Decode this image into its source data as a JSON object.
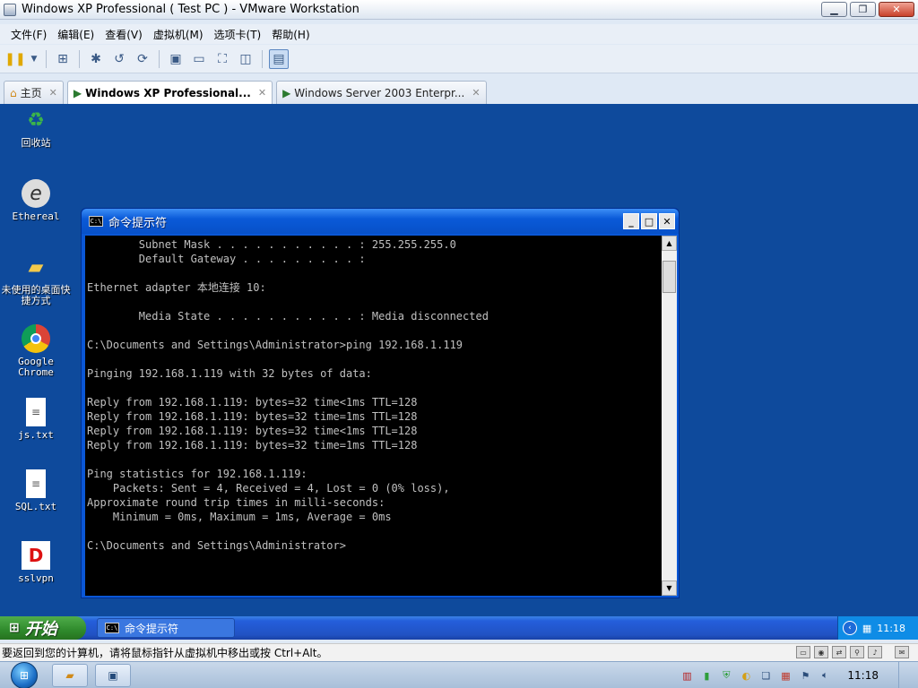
{
  "host_window": {
    "title": "Windows XP Professional ( Test PC ) - VMware Workstation",
    "menu": [
      "文件(F)",
      "编辑(E)",
      "查看(V)",
      "虚拟机(M)",
      "选项卡(T)",
      "帮助(H)"
    ],
    "toolbar_icons": [
      "pause-icon",
      "dropdown-icon",
      "network-icon",
      "snapshot-icon",
      "revert-icon",
      "snapshot-manager-icon",
      "console-view-icon",
      "quick-switch-icon",
      "fullscreen-icon",
      "unity-icon",
      "library-icon"
    ],
    "tabs": [
      {
        "label": "主页",
        "icon": "home-icon",
        "active": false
      },
      {
        "label": "Windows XP Professional...",
        "icon": "vm-icon",
        "active": true
      },
      {
        "label": "Windows Server 2003 Enterpr...",
        "icon": "vm-icon",
        "active": false
      }
    ]
  },
  "desktop": {
    "icons": [
      {
        "label": "回收站",
        "icon": "recycle-bin-icon"
      },
      {
        "label": "Ethereal",
        "icon": "ethereal-icon"
      },
      {
        "label": "未使用的桌面快捷方式",
        "icon": "folder-icon"
      },
      {
        "label": "Google Chrome",
        "icon": "chrome-icon"
      },
      {
        "label": "js.txt",
        "icon": "text-file-icon"
      },
      {
        "label": "SQL.txt",
        "icon": "text-file-icon"
      },
      {
        "label": "sslvpn",
        "icon": "sslvpn-icon"
      }
    ]
  },
  "cmd": {
    "title": "命令提示符",
    "icon_text": "C:\\",
    "lines": [
      "        Subnet Mask . . . . . . . . . . . : 255.255.255.0",
      "        Default Gateway . . . . . . . . . :",
      "",
      "Ethernet adapter 本地连接 10:",
      "",
      "        Media State . . . . . . . . . . . : Media disconnected",
      "",
      "C:\\Documents and Settings\\Administrator>ping 192.168.1.119",
      "",
      "Pinging 192.168.1.119 with 32 bytes of data:",
      "",
      "Reply from 192.168.1.119: bytes=32 time<1ms TTL=128",
      "Reply from 192.168.1.119: bytes=32 time=1ms TTL=128",
      "Reply from 192.168.1.119: bytes=32 time<1ms TTL=128",
      "Reply from 192.168.1.119: bytes=32 time=1ms TTL=128",
      "",
      "Ping statistics for 192.168.1.119:",
      "    Packets: Sent = 4, Received = 4, Lost = 0 (0% loss),",
      "Approximate round trip times in milli-seconds:",
      "    Minimum = 0ms, Maximum = 1ms, Average = 0ms",
      "",
      "C:\\Documents and Settings\\Administrator>"
    ]
  },
  "xp_taskbar": {
    "start_label": "开始",
    "task_label": "命令提示符",
    "clock": "11:18"
  },
  "status_bar": {
    "hint": "要返回到您的计算机，请将鼠标指针从虚拟机中移出或按 Ctrl+Alt。"
  },
  "win7_taskbar": {
    "clock": "11:18"
  },
  "colors": {
    "desktop_bg": "#0e4a9c",
    "cmd_text": "#c0c0c0",
    "xp_start_green": "#2f8a2c"
  }
}
